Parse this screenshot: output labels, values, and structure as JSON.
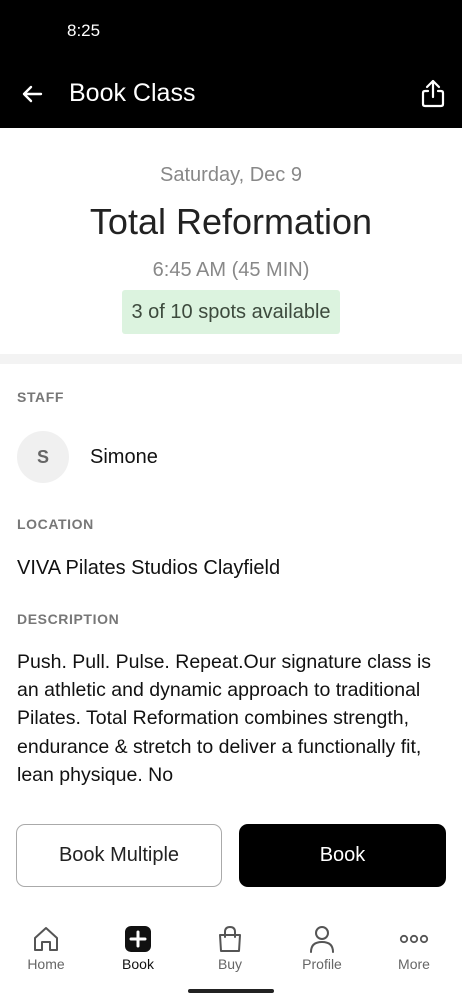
{
  "status_bar": {
    "time": "8:25"
  },
  "app_bar": {
    "title": "Book Class",
    "back_icon": "arrow-left-icon",
    "share_icon": "share-icon"
  },
  "class": {
    "date": "Saturday, Dec 9",
    "name": "Total Reformation",
    "time": "6:45 AM (45 MIN)",
    "spots": "3 of 10 spots available",
    "spots_color": "#dcf3df"
  },
  "staff": {
    "label": "STAFF",
    "initial": "S",
    "name": "Simone"
  },
  "location": {
    "label": "LOCATION",
    "name": "VIVA Pilates Studios Clayfield"
  },
  "description": {
    "label": "DESCRIPTION",
    "text": "Push. Pull. Pulse. Repeat.Our signature class is an athletic and dynamic approach to traditional Pilates. Total Reformation combines strength, endurance & stretch to deliver a functionally fit, lean physique. No"
  },
  "actions": {
    "book_multiple": "Book Multiple",
    "book": "Book"
  },
  "bottom_nav": {
    "items": [
      {
        "label": "Home",
        "icon": "home-icon"
      },
      {
        "label": "Book",
        "icon": "plus-square-icon",
        "active": true
      },
      {
        "label": "Buy",
        "icon": "shopping-bag-icon"
      },
      {
        "label": "Profile",
        "icon": "person-icon"
      },
      {
        "label": "More",
        "icon": "more-dots-icon"
      }
    ]
  }
}
